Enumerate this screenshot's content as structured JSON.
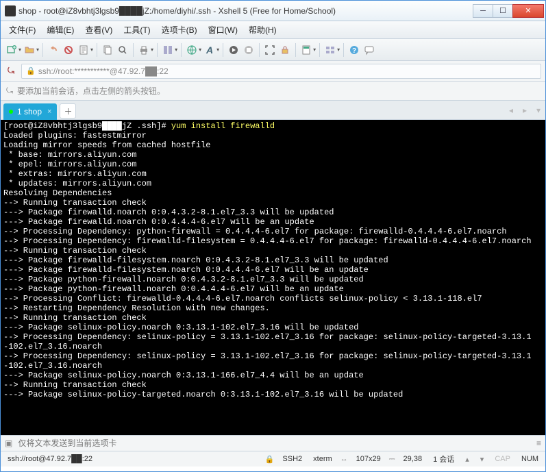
{
  "window": {
    "title": "shop - root@iZ8vbhtj3lgsb9████jZ:/home/diyhi/.ssh - Xshell 5 (Free for Home/School)"
  },
  "menu": {
    "file": "文件(F)",
    "edit": "编辑(E)",
    "view": "查看(V)",
    "tools": "工具(T)",
    "options": "选项卡(B)",
    "window": "窗口(W)",
    "help": "帮助(H)"
  },
  "address": "ssh://root:***********@47.92.7██:22",
  "hint_text": "要添加当前会话，点击左侧的箭头按钮。",
  "tab": {
    "label": "1 shop"
  },
  "terminal": {
    "prompt": "[root@iZ8vbhtj3lgsb9████jZ .ssh]# ",
    "command": "yum install firewalld",
    "lines": [
      "Loaded plugins: fastestmirror",
      "Loading mirror speeds from cached hostfile",
      " * base: mirrors.aliyun.com",
      " * epel: mirrors.aliyun.com",
      " * extras: mirrors.aliyun.com",
      " * updates: mirrors.aliyun.com",
      "Resolving Dependencies",
      "--> Running transaction check",
      "---> Package firewalld.noarch 0:0.4.3.2-8.1.el7_3.3 will be updated",
      "---> Package firewalld.noarch 0:0.4.4.4-6.el7 will be an update",
      "--> Processing Dependency: python-firewall = 0.4.4.4-6.el7 for package: firewalld-0.4.4.4-6.el7.noarch",
      "--> Processing Dependency: firewalld-filesystem = 0.4.4.4-6.el7 for package: firewalld-0.4.4.4-6.el7.noarch",
      "--> Running transaction check",
      "---> Package firewalld-filesystem.noarch 0:0.4.3.2-8.1.el7_3.3 will be updated",
      "---> Package firewalld-filesystem.noarch 0:0.4.4.4-6.el7 will be an update",
      "---> Package python-firewall.noarch 0:0.4.3.2-8.1.el7_3.3 will be updated",
      "---> Package python-firewall.noarch 0:0.4.4.4-6.el7 will be an update",
      "--> Processing Conflict: firewalld-0.4.4.4-6.el7.noarch conflicts selinux-policy < 3.13.1-118.el7",
      "--> Restarting Dependency Resolution with new changes.",
      "--> Running transaction check",
      "---> Package selinux-policy.noarch 0:3.13.1-102.el7_3.16 will be updated",
      "--> Processing Dependency: selinux-policy = 3.13.1-102.el7_3.16 for package: selinux-policy-targeted-3.13.1",
      "-102.el7_3.16.noarch",
      "--> Processing Dependency: selinux-policy = 3.13.1-102.el7_3.16 for package: selinux-policy-targeted-3.13.1",
      "-102.el7_3.16.noarch",
      "---> Package selinux-policy.noarch 0:3.13.1-166.el7_4.4 will be an update",
      "--> Running transaction check",
      "---> Package selinux-policy-targeted.noarch 0:3.13.1-102.el7_3.16 will be updated"
    ]
  },
  "input_placeholder": "仅将文本发送到当前选项卡",
  "status": {
    "path": "ssh://root@47.92.7██:22",
    "ssh": "SSH2",
    "term": "xterm",
    "size": "107x29",
    "pos": "29,38",
    "sessions": "1 会话",
    "cap": "CAP",
    "num": "NUM"
  }
}
